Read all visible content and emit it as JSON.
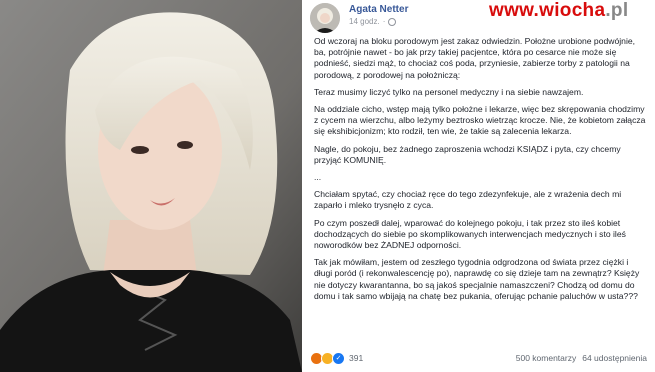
{
  "post": {
    "author": "Agata Netter",
    "time": "14 godz.",
    "paragraphs": [
      "Od wczoraj na bloku porodowym jest zakaz odwiedzin. Położne urobione podwójnie, ba, potrójnie nawet - bo jak przy takiej pacjentce, która po cesarce nie może się podnieść, siedzi mąż, to chociaż coś poda, przyniesie, zabierze torby z patologii na porodową, z porodowej na położniczą:",
      "Teraz musimy liczyć tylko na personel medyczny i na siebie nawzajem.",
      "Na oddziale cicho, wstęp mają tylko położne i lekarze, więc bez skrępowania chodzimy z cycem na wierzchu, albo leżymy beztrosko wietrząc krocze. Nie, że kobietom załącza się ekshibicjonizm; kto rodził, ten wie, że takie są zalecenia lekarza.",
      "Nagle, do pokoju, bez żadnego zaproszenia wchodzi KSIĄDZ i pyta, czy chcemy przyjąć KOMUNIĘ.",
      "...",
      "Chciałam spytać, czy chociaż ręce do tego zdezynfekuje, ale z wrażenia dech mi zaparło i mleko trysnęło z cyca.",
      "Po czym poszedł dalej, wparować do kolejnego pokoju, i tak przez sto ileś kobiet dochodzących do siebie po skomplikowanych interwencjach medycznych i sto ileś noworodków bez ŻADNEJ odporności.",
      "Tak jak mówiłam, jestem od zeszłego tygodnia odgrodzona od świata przez ciężki i długi poród (i rekonwalescencję po), naprawdę co się dzieje tam na zewnątrz? Księży nie dotyczy kwarantanna, bo są jakoś specjalnie namaszczeni? Chodzą od domu do domu i tak samo wbijają na chatę bez pukania, oferując pchanie paluchów w usta???"
    ],
    "reaction_count": "391",
    "comments": "500 komentarzy",
    "shares": "64 udostępnienia"
  },
  "watermark": {
    "prefix": "www.",
    "name": "wiocha",
    "suffix": ".pl"
  },
  "colors": {
    "author": "#385898",
    "watermark": "#d80c0c",
    "text": "#1d2129"
  }
}
